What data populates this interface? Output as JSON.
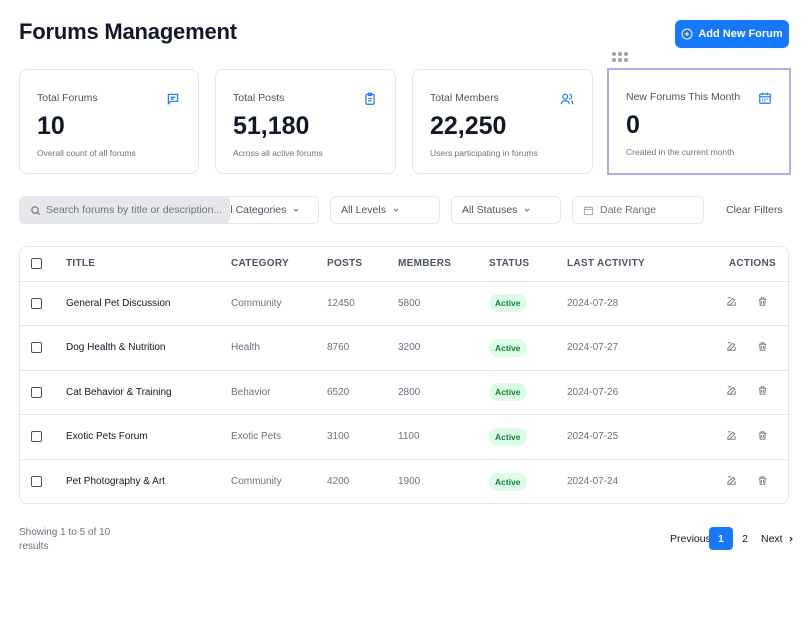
{
  "page": {
    "title": "Forums Management"
  },
  "header": {
    "add_button_label": "Add New Forum"
  },
  "stats": [
    {
      "label": "Total Forums",
      "value": "10",
      "sub": "Overall count of all forums",
      "icon": "chat-icon"
    },
    {
      "label": "Total Posts",
      "value": "51,180",
      "sub": "Across all active forums",
      "icon": "clipboard-icon"
    },
    {
      "label": "Total Members",
      "value": "22,250",
      "sub": "Users participating in forums",
      "icon": "users-icon"
    },
    {
      "label": "New Forums This Month",
      "value": "0",
      "sub": "Created in the current month",
      "icon": "calendar-icon"
    }
  ],
  "filters": {
    "search_placeholder": "Search forums by title or description...",
    "category": "All Categories",
    "level": "All Levels",
    "status": "All Statuses",
    "date_placeholder": "Date Range",
    "clear_label": "Clear Filters"
  },
  "table": {
    "headers": {
      "title": "TITLE",
      "category": "CATEGORY",
      "posts": "POSTS",
      "members": "MEMBERS",
      "status": "STATUS",
      "last_activity": "LAST ACTIVITY",
      "actions": "ACTIONS"
    },
    "rows": [
      {
        "title": "General Pet Discussion",
        "category": "Community",
        "posts": "12450",
        "members": "5800",
        "status": "Active",
        "last_activity": "2024-07-28"
      },
      {
        "title": "Dog Health & Nutrition",
        "category": "Health",
        "posts": "8760",
        "members": "3200",
        "status": "Active",
        "last_activity": "2024-07-27"
      },
      {
        "title": "Cat Behavior & Training",
        "category": "Behavior",
        "posts": "6520",
        "members": "2800",
        "status": "Active",
        "last_activity": "2024-07-26"
      },
      {
        "title": "Exotic Pets Forum",
        "category": "Exotic Pets",
        "posts": "3100",
        "members": "1100",
        "status": "Active",
        "last_activity": "2024-07-25"
      },
      {
        "title": "Pet Photography & Art",
        "category": "Community",
        "posts": "4200",
        "members": "1900",
        "status": "Active",
        "last_activity": "2024-07-24"
      }
    ]
  },
  "footer": {
    "showing": "Showing 1 to 5 of 10 results",
    "prev_label": "Previous",
    "pages": [
      "1",
      "2"
    ],
    "current_page": "1",
    "next_label": "Next"
  },
  "colors": {
    "accent": "#1677ff",
    "active_badge_bg": "#dcfce7",
    "active_badge_text": "#15803d",
    "selected_card_border": "#b3aee6"
  }
}
